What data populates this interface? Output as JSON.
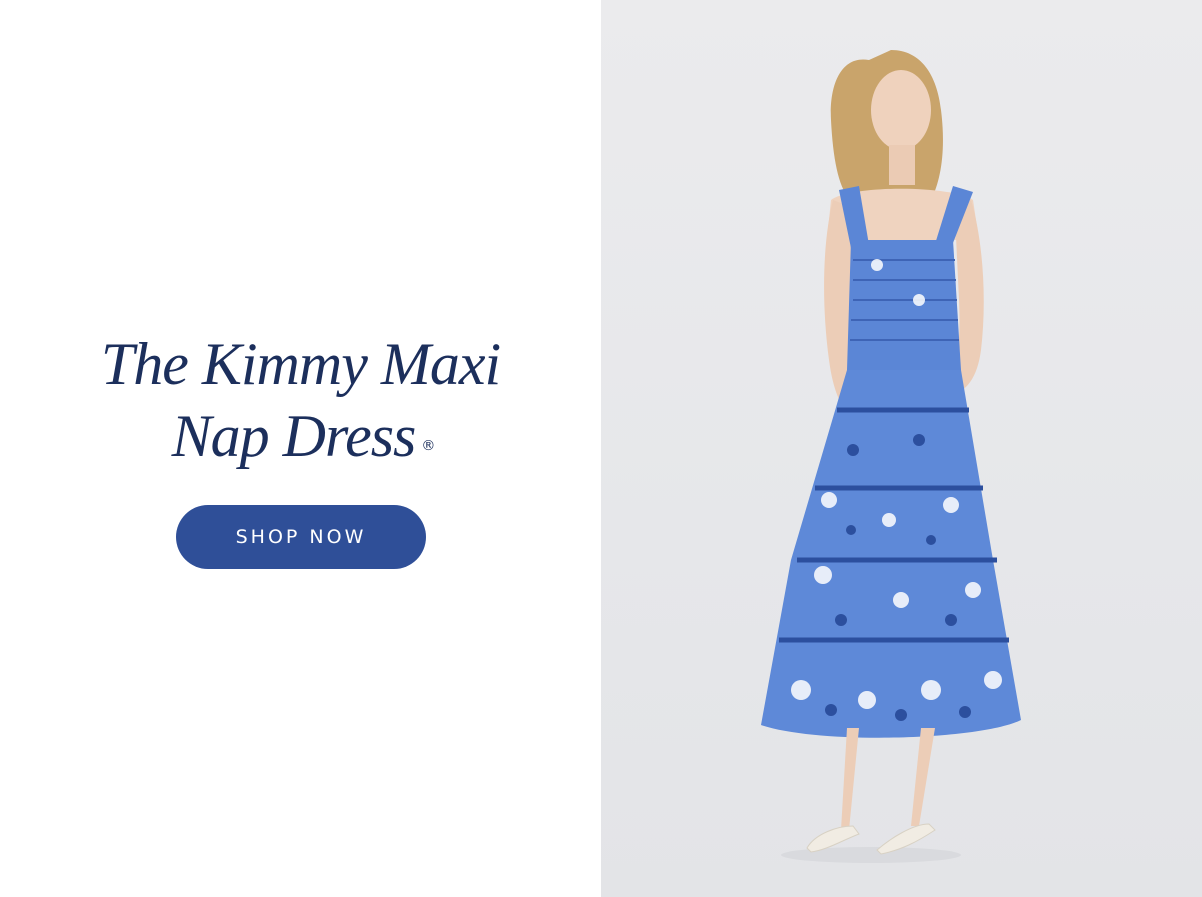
{
  "banner": {
    "headline_line1": "The Kimmy Maxi",
    "headline_line2": "Nap Dress",
    "registered_mark": "®",
    "cta_label": "SHOP NOW"
  },
  "colors": {
    "headline": "#1c2f5c",
    "button_bg": "#2f4f98",
    "button_text": "#ffffff",
    "photo_bg": "#e8e9ec",
    "dress_blue": "#5b86d6",
    "dress_print": "#2c4f9e"
  },
  "image": {
    "subject": "model-in-blue-maxi-dress-photo"
  }
}
